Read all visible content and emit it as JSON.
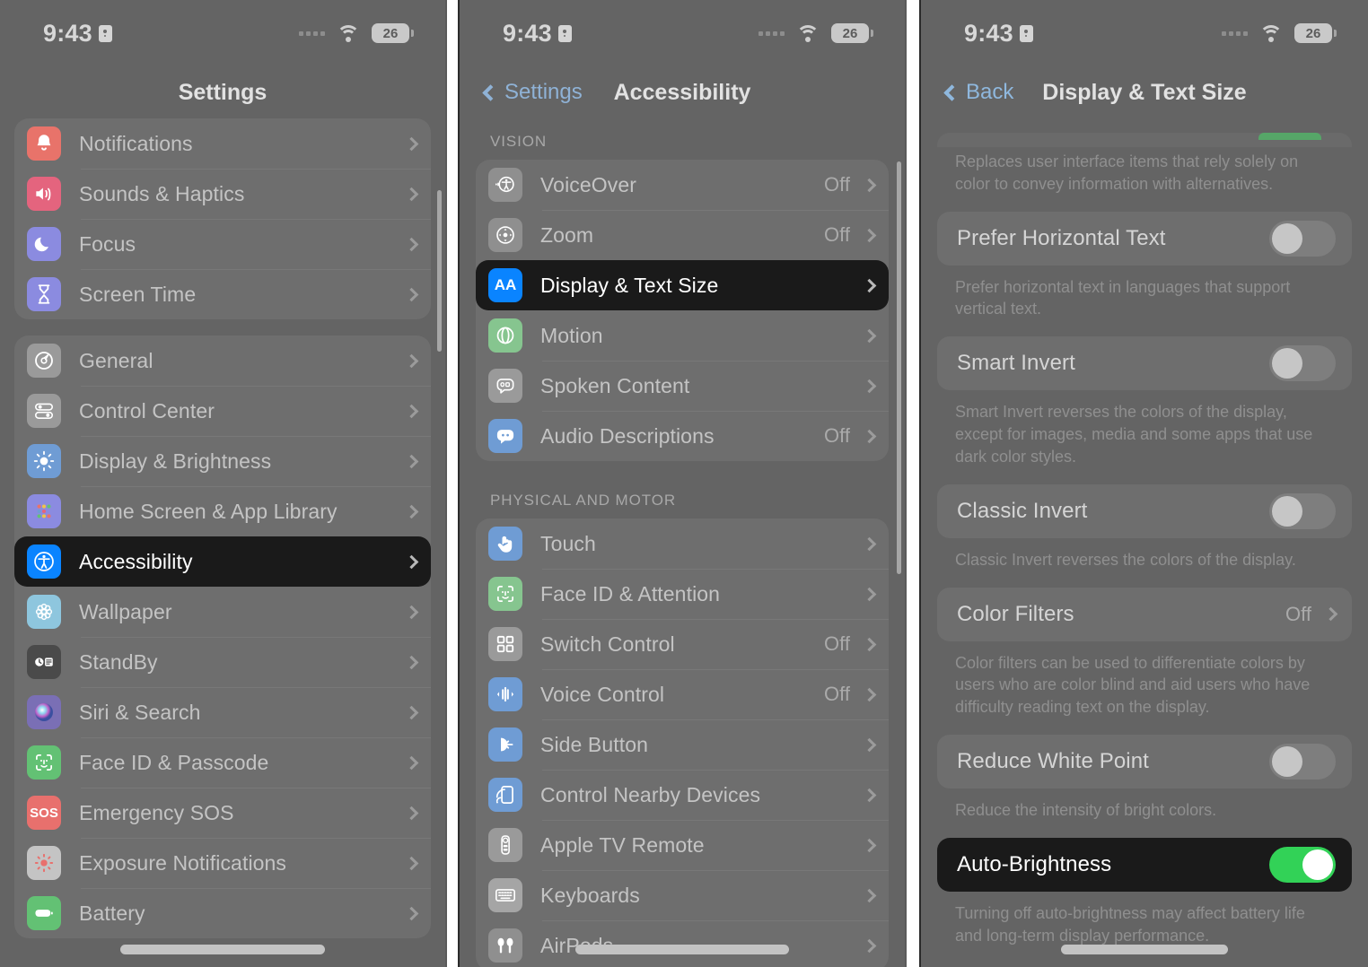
{
  "status_bar": {
    "time": "9:43",
    "battery_level": "26",
    "lock_icon": "lock-portrait-icon",
    "wifi_icon": "wifi-icon",
    "signal_icon": "cellular-signal-icon"
  },
  "panel1": {
    "nav": {
      "title": "Settings"
    },
    "groups": [
      {
        "items": [
          {
            "label": "Notifications",
            "icon": "notifications-bell-icon",
            "color": "#e8736a",
            "value": ""
          },
          {
            "label": "Sounds & Haptics",
            "icon": "sounds-speaker-icon",
            "color": "#e4647e",
            "value": ""
          },
          {
            "label": "Focus",
            "icon": "focus-moon-icon",
            "color": "#8b8be0",
            "value": ""
          },
          {
            "label": "Screen Time",
            "icon": "screen-time-hourglass-icon",
            "color": "#8b8be0",
            "value": ""
          }
        ]
      },
      {
        "items": [
          {
            "label": "General",
            "icon": "general-gear-icon",
            "color": "#9a9a9a",
            "value": ""
          },
          {
            "label": "Control Center",
            "icon": "control-center-icon",
            "color": "#9a9a9a",
            "value": ""
          },
          {
            "label": "Display & Brightness",
            "icon": "display-brightness-sun-icon",
            "color": "#6f9cd4",
            "value": ""
          },
          {
            "label": "Home Screen & App Library",
            "icon": "home-screen-grid-icon",
            "color": "#8b8be0",
            "value": ""
          },
          {
            "label": "Accessibility",
            "icon": "accessibility-person-icon",
            "color": "#0a84ff",
            "value": "",
            "selected": true
          },
          {
            "label": "Wallpaper",
            "icon": "wallpaper-flower-icon",
            "color": "#8ec6de",
            "value": ""
          },
          {
            "label": "StandBy",
            "icon": "standby-clock-icon",
            "color": "#4a4a4a",
            "value": ""
          },
          {
            "label": "Siri & Search",
            "icon": "siri-orb-icon",
            "color": "#7a6fb5",
            "value": ""
          },
          {
            "label": "Face ID & Passcode",
            "icon": "face-id-icon",
            "color": "#63c174",
            "value": ""
          },
          {
            "label": "Emergency SOS",
            "icon": "emergency-sos-icon",
            "color": "#e8706d",
            "value": ""
          },
          {
            "label": "Exposure Notifications",
            "icon": "exposure-notifications-icon",
            "color": "#c4c4c4",
            "value": ""
          },
          {
            "label": "Battery",
            "icon": "battery-icon",
            "color": "#63c174",
            "value": ""
          }
        ]
      }
    ]
  },
  "panel2": {
    "nav": {
      "back_label": "Settings",
      "title": "Accessibility"
    },
    "sections": [
      {
        "header": "VISION",
        "items": [
          {
            "label": "VoiceOver",
            "icon": "voiceover-icon",
            "color": "#8f8f8f",
            "value": "Off"
          },
          {
            "label": "Zoom",
            "icon": "zoom-icon",
            "color": "#8f8f8f",
            "value": ""
          },
          {
            "label": "Display & Text Size",
            "icon": "display-text-size-aa-icon",
            "color": "#0a84ff",
            "value": "",
            "selected": true
          },
          {
            "label": "Motion",
            "icon": "motion-icon",
            "color": "#86c58f",
            "value": ""
          },
          {
            "label": "Spoken Content",
            "icon": "spoken-content-icon",
            "color": "#9a9a9a",
            "value": ""
          },
          {
            "label": "Audio Descriptions",
            "icon": "audio-descriptions-icon",
            "color": "#6f9cd4",
            "value": "Off"
          }
        ]
      },
      {
        "header": "PHYSICAL AND MOTOR",
        "items": [
          {
            "label": "Touch",
            "icon": "touch-hand-icon",
            "color": "#6f9cd4",
            "value": ""
          },
          {
            "label": "Face ID & Attention",
            "icon": "face-id-attention-icon",
            "color": "#86c58f",
            "value": ""
          },
          {
            "label": "Switch Control",
            "icon": "switch-control-icon",
            "color": "#9a9a9a",
            "value": "Off"
          },
          {
            "label": "Voice Control",
            "icon": "voice-control-icon",
            "color": "#6f9cd4",
            "value": "Off"
          },
          {
            "label": "Side Button",
            "icon": "side-button-icon",
            "color": "#6f9cd4",
            "value": ""
          },
          {
            "label": "Control Nearby Devices",
            "icon": "control-nearby-devices-icon",
            "color": "#6f9cd4",
            "value": ""
          },
          {
            "label": "Apple TV Remote",
            "icon": "apple-tv-remote-icon",
            "color": "#9a9a9a",
            "value": ""
          },
          {
            "label": "Keyboards",
            "icon": "keyboards-icon",
            "color": "#a5a5a5",
            "value": ""
          },
          {
            "label": "AirPods",
            "icon": "airpods-icon",
            "color": "#8f8f8f",
            "value": ""
          }
        ]
      }
    ],
    "zoom_value": "Off"
  },
  "panel3": {
    "nav": {
      "back_label": "Back",
      "title": "Display & Text Size"
    },
    "items": [
      {
        "kind": "footnote",
        "text": "Replaces user interface items that rely solely on color to convey information with alternatives."
      },
      {
        "kind": "toggle",
        "label": "Prefer Horizontal Text",
        "on": false,
        "footnote": "Prefer horizontal text in languages that support vertical text."
      },
      {
        "kind": "toggle",
        "label": "Smart Invert",
        "on": false,
        "footnote": "Smart Invert reverses the colors of the display, except for images, media and some apps that use dark color styles."
      },
      {
        "kind": "toggle",
        "label": "Classic Invert",
        "on": false,
        "footnote": "Classic Invert reverses the colors of the display."
      },
      {
        "kind": "link",
        "label": "Color Filters",
        "value": "Off",
        "footnote": "Color filters can be used to differentiate colors by users who are color blind and aid users who have difficulty reading text on the display."
      },
      {
        "kind": "toggle",
        "label": "Reduce White Point",
        "on": false,
        "footnote": "Reduce the intensity of bright colors."
      },
      {
        "kind": "toggle",
        "label": "Auto-Brightness",
        "on": true,
        "selected": true,
        "footnote": "Turning off auto-brightness may affect battery life and long-term display performance."
      }
    ]
  },
  "colors": {
    "accent_blue": "#0a84ff",
    "toggle_on_green": "#32d257",
    "highlight_black": "#1a1a1a",
    "nav_link_blue": "#8fb2d6"
  }
}
